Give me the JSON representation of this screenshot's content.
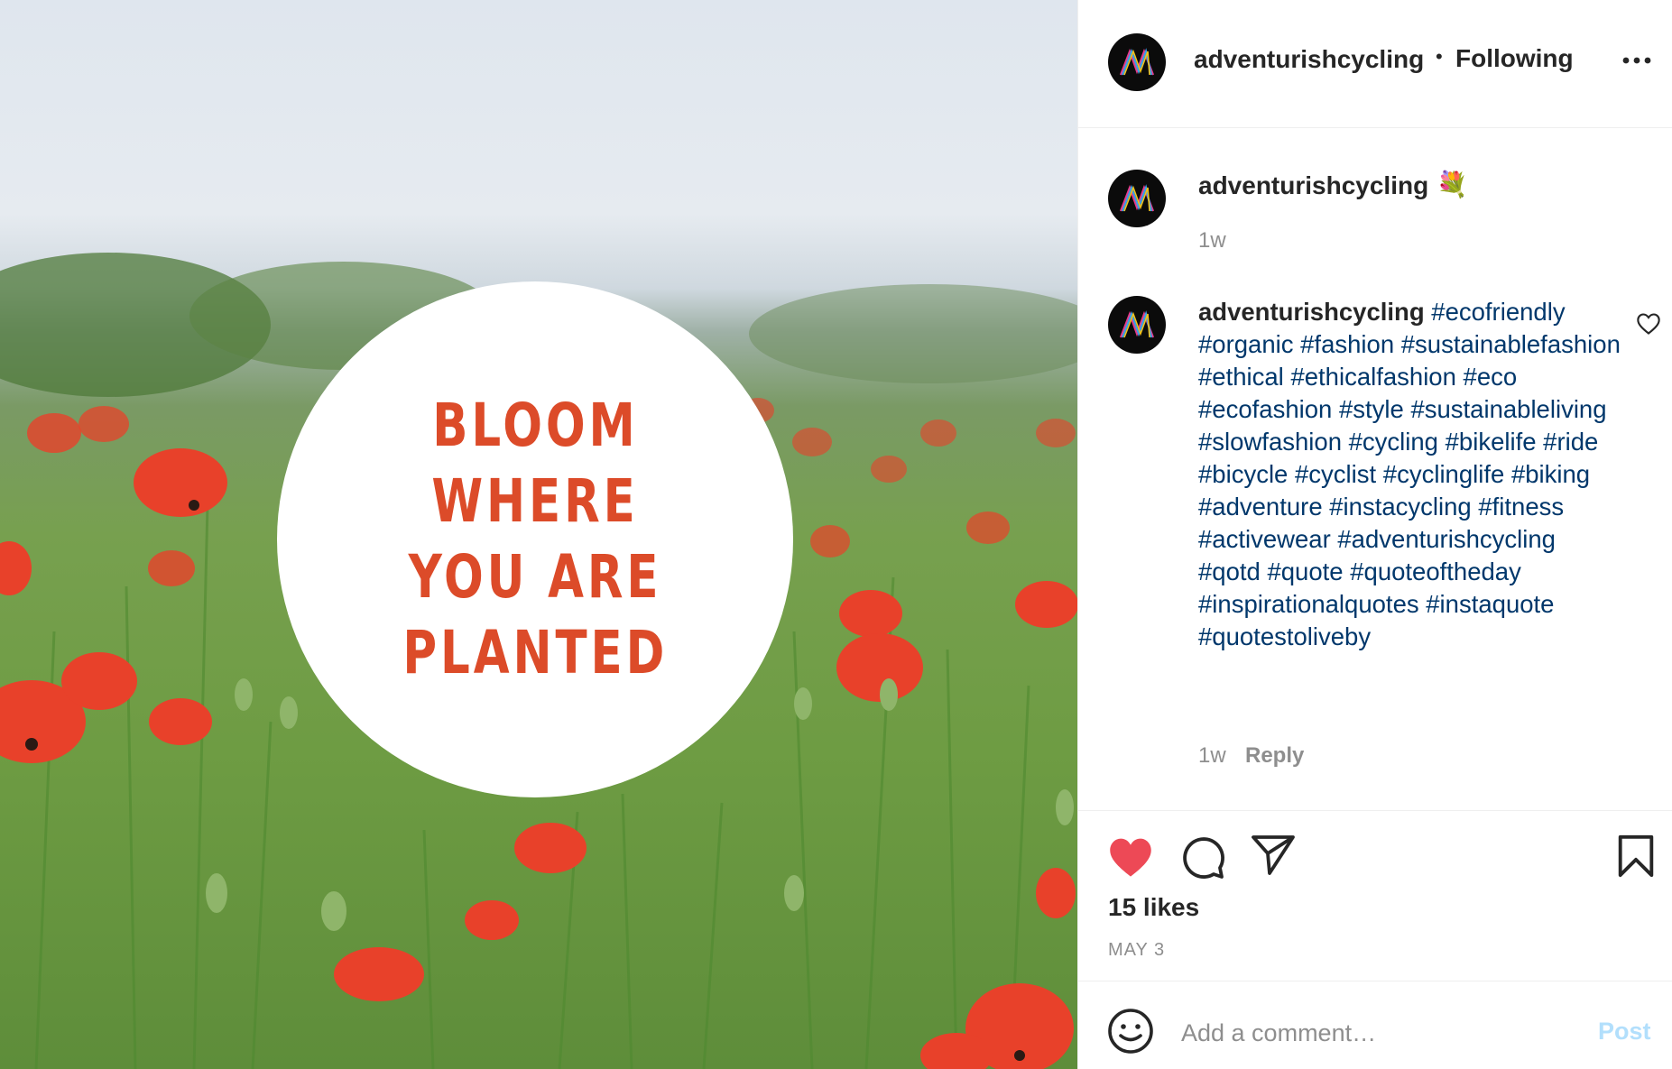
{
  "post": {
    "quote_lines": [
      "BLOOM",
      "WHERE",
      "YOU ARE",
      "PLANTED"
    ]
  },
  "header": {
    "username": "adventurishcycling",
    "separator": "•",
    "follow_status": "Following"
  },
  "first_comment": {
    "username": "adventurishcycling",
    "emoji": "💐",
    "time": "1w"
  },
  "caption": {
    "username": "adventurishcycling",
    "hashtags": [
      "#ecofriendly",
      "#organic",
      "#fashion",
      "#sustainablefashion",
      "#ethical",
      "#ethicalfashion",
      "#eco",
      "#ecofashion",
      "#style",
      "#sustainableliving",
      "#slowfashion",
      "#cycling",
      "#bikelife",
      "#ride",
      "#bicycle",
      "#cyclist",
      "#cyclinglife",
      "#biking",
      "#adventure",
      "#instacycling",
      "#fitness",
      "#activewear",
      "#adventurishcycling",
      "#qotd",
      "#quote",
      "#quoteoftheday",
      "#inspirationalquotes",
      "#instaquote",
      "#quotestoliveby"
    ],
    "time": "1w",
    "reply_label": "Reply"
  },
  "actions": {
    "likes": "15 likes",
    "date": "MAY 3"
  },
  "comment_box": {
    "placeholder": "Add a comment…",
    "post_label": "Post"
  },
  "colors": {
    "quote_text": "#dc4b29",
    "hashtag": "#00376b",
    "liked_heart": "#ed4956",
    "post_button": "#b2dffc"
  },
  "icons": [
    "more-options-icon",
    "bouquet-emoji",
    "like-icon-small",
    "heart-filled-icon",
    "comment-icon",
    "share-icon",
    "bookmark-icon",
    "emoji-icon"
  ]
}
